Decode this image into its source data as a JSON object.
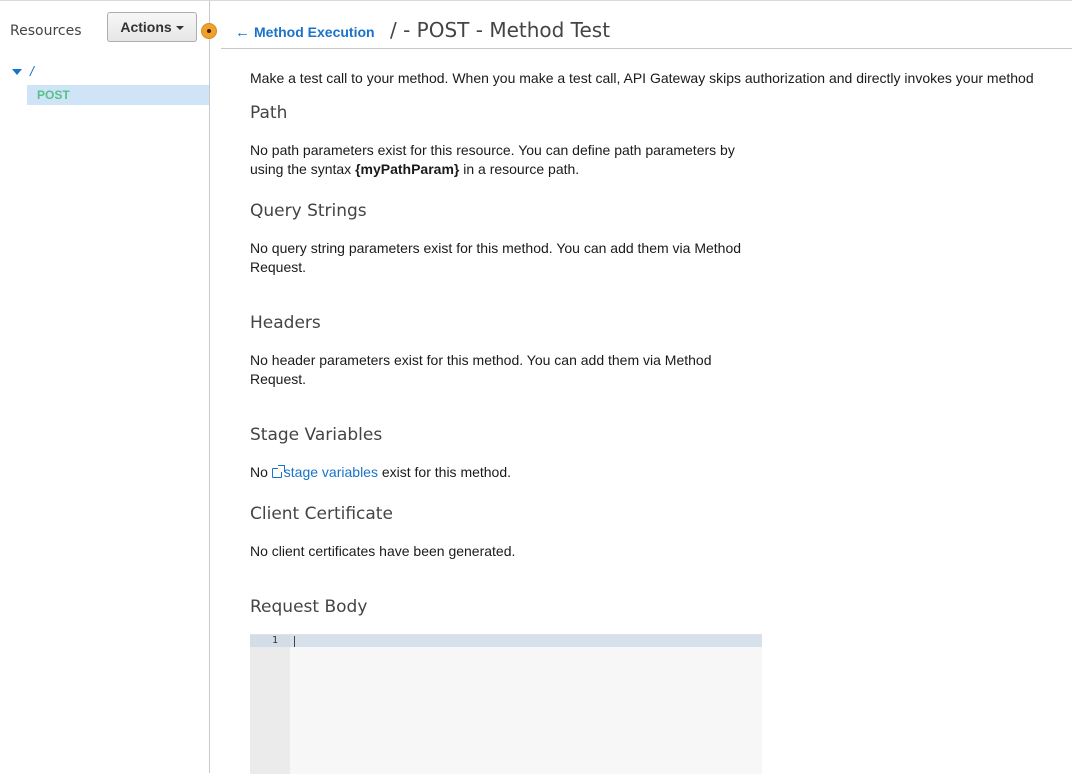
{
  "sidebar": {
    "resources_label": "Resources",
    "actions_label": "Actions",
    "tree": {
      "root": "/",
      "method": "POST"
    }
  },
  "header": {
    "back_label": "Method Execution",
    "title": "/ - POST - Method Test"
  },
  "intro": "Make a test call to your method. When you make a test call, API Gateway skips authorization and directly invokes your method",
  "sections": {
    "path": {
      "heading": "Path",
      "text_before": "No path parameters exist for this resource. You can define path parameters by using the syntax ",
      "syntax": "{myPathParam}",
      "text_after": " in a resource path."
    },
    "query": {
      "heading": "Query Strings",
      "text": "No query string parameters exist for this method. You can add them via Method Request."
    },
    "headers": {
      "heading": "Headers",
      "text": "No header parameters exist for this method. You can add them via Method Request."
    },
    "stage": {
      "heading": "Stage Variables",
      "text_before": "No ",
      "link": "stage variables",
      "text_after": " exist for this method."
    },
    "cert": {
      "heading": "Client Certificate",
      "text": "No client certificates have been generated."
    },
    "body": {
      "heading": "Request Body",
      "line_number": "1",
      "value": ""
    }
  },
  "colors": {
    "link": "#1a73c8",
    "post_method": "#59c08a",
    "selected_row": "#cfe5f7"
  }
}
